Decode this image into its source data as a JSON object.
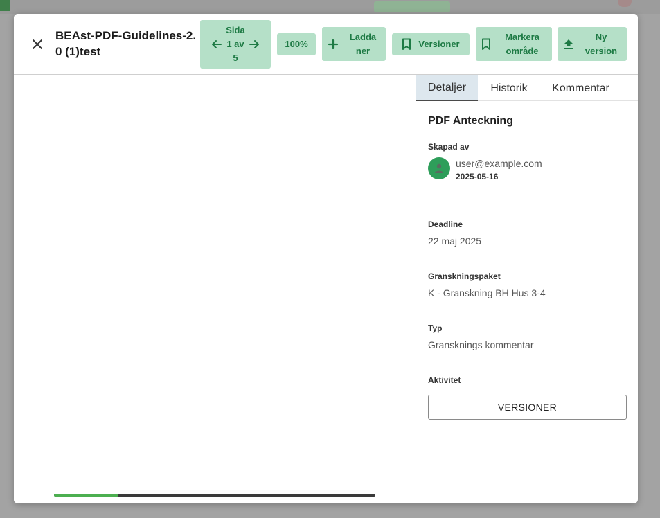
{
  "colors": {
    "button_bg": "#b5e0c8",
    "button_text": "#1d7a44",
    "avatar": "#2e9e5a",
    "progress": "#4caf50",
    "active_tab": "#dde7ee"
  },
  "header": {
    "title": "BEAst-PDF-Guidelines-2.0 (1)test",
    "close_icon": "close-icon"
  },
  "toolbar": {
    "page": {
      "label": "Sida",
      "indicator": "1 av",
      "total": "5"
    },
    "zoom": "100%",
    "download": "Ladda ner",
    "versions": "Versioner",
    "mark_area": "Markera område",
    "new_version": "Ny version"
  },
  "viewer": {
    "progress_fraction": 0.2
  },
  "panel": {
    "tabs": [
      {
        "label": "Detaljer",
        "active": true
      },
      {
        "label": "Historik",
        "active": false
      },
      {
        "label": "Kommentar",
        "active": false
      }
    ],
    "title": "PDF Anteckning",
    "created_by_label": "Skapad av",
    "created_by_email": "user@example.com",
    "created_date": "2025-05-16",
    "deadline_label": "Deadline",
    "deadline_value": "22 maj 2025",
    "package_label": "Granskningspaket",
    "package_value": "K - Granskning BH Hus 3-4",
    "type_label": "Typ",
    "type_value": "Gransknings kommentar",
    "activity_label": "Aktivitet",
    "activity_button": "VERSIONER"
  }
}
